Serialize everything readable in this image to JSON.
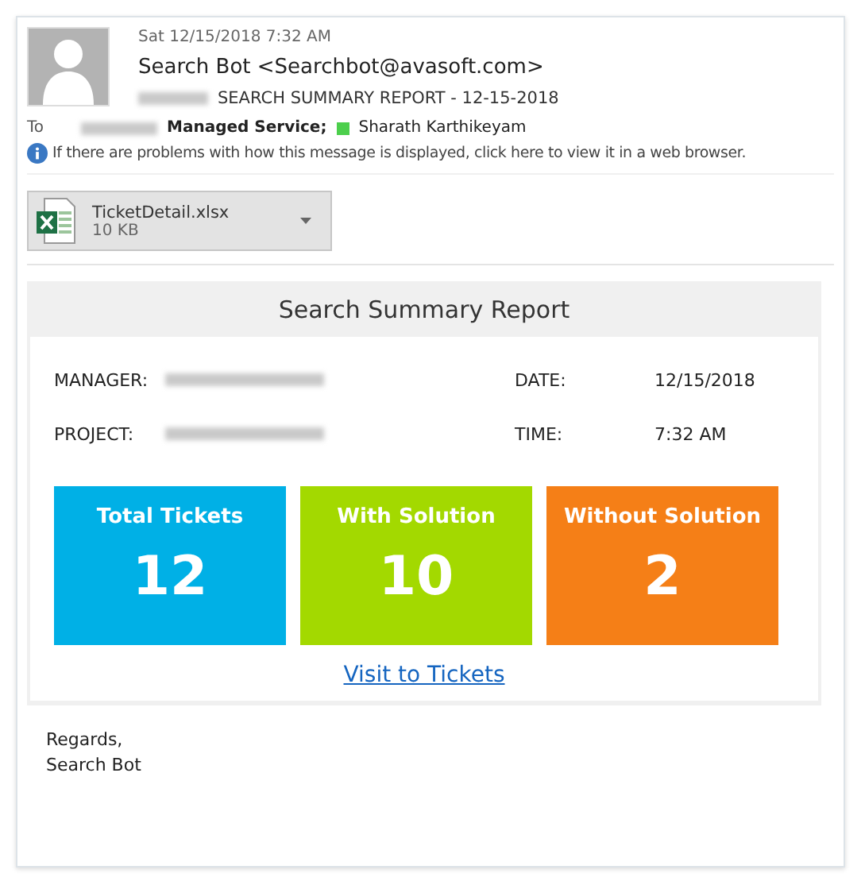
{
  "header": {
    "sent": "Sat 12/15/2018 7:32 AM",
    "from": "Search Bot <Searchbot@avasoft.com>",
    "subject": "SEARCH SUMMARY REPORT - 12-15-2018",
    "to_label": "To",
    "recipients": [
      {
        "name": "Managed Service;",
        "kind": "group"
      },
      {
        "name": "Sharath Karthikeyam",
        "kind": "person"
      }
    ],
    "info": "If there are problems with how this message is displayed, click here to view it in a web browser."
  },
  "attachment": {
    "name": "TicketDetail.xlsx",
    "size": "10 KB"
  },
  "report": {
    "title": "Search Summary Report",
    "fields": [
      {
        "label": "MANAGER:",
        "value_redacted": true
      },
      {
        "label": "DATE:",
        "value": "12/15/2018"
      },
      {
        "label": "PROJECT:",
        "value_redacted": true
      },
      {
        "label": "TIME:",
        "value": "7:32 AM"
      }
    ],
    "tiles": [
      {
        "label": "Total Tickets",
        "count": "12",
        "color": "#00b0e6"
      },
      {
        "label": "With Solution",
        "count": "10",
        "color": "#a3d900"
      },
      {
        "label": "Without Solution",
        "count": "2",
        "color": "#f57f17"
      }
    ],
    "link": "Visit to Tickets"
  },
  "signature": [
    "Regards,",
    "Search Bot"
  ]
}
